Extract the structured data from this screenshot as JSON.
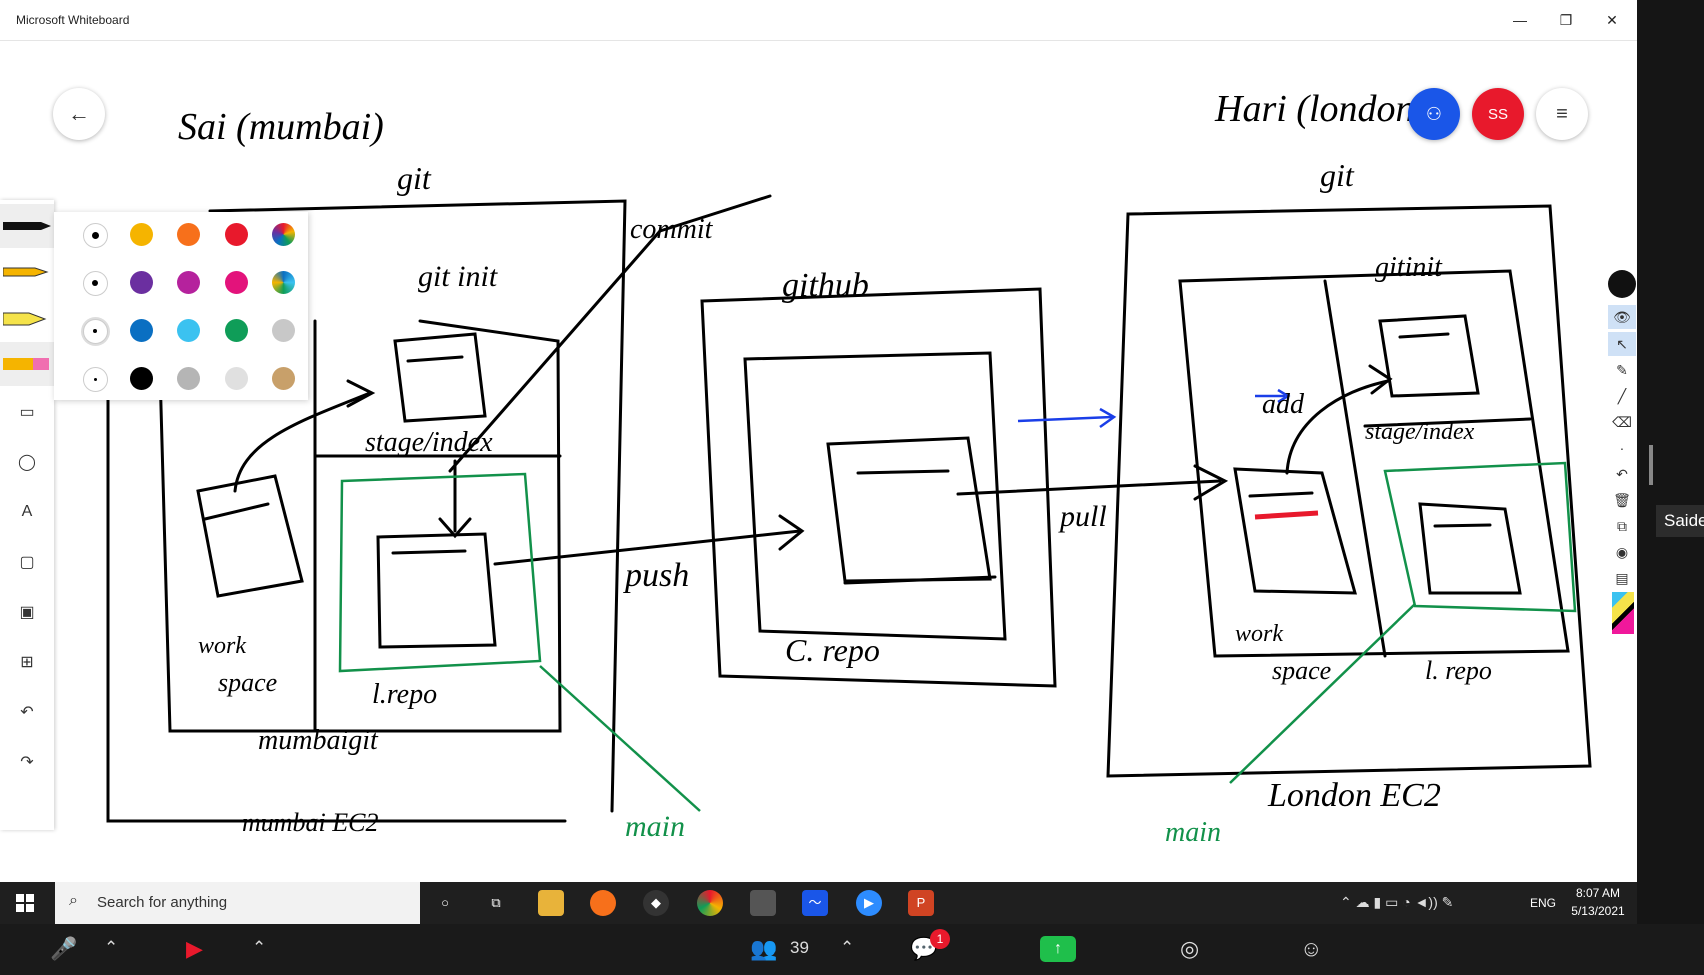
{
  "window": {
    "title": "Microsoft Whiteboard",
    "minimize": "—",
    "restore": "❐",
    "close": "✕"
  },
  "header": {
    "avatar_initials": "SS"
  },
  "sketch": {
    "left_title": "Sai (mumbai)",
    "left_git": "git",
    "git_init": "git init",
    "commit": "commit",
    "stage_index": "stage/index",
    "work_space_1": "work",
    "work_space_2": "space",
    "local_repo": "l.repo",
    "mumbai_git": "mumbaigit",
    "mumbai_ec2": "mumbai EC2",
    "main_left": "main",
    "push": "push",
    "github": "github",
    "central_repo": "C. repo",
    "pull": "pull",
    "right_title": "Hari (london)",
    "right_git": "git",
    "right_git_init": "gitinit",
    "add": "add",
    "right_stage_index": "stage/index",
    "right_work_1": "work",
    "right_work_2": "space",
    "right_local_repo": "l. repo",
    "london_ec2": "London EC2",
    "main_right": "main"
  },
  "palette": {
    "rows": [
      [
        "#000000",
        "#f5b400",
        "#f7701b",
        "#e8192c",
        "rainbow"
      ],
      [
        "#000000",
        "#6b2fa0",
        "#b5229d",
        "#e3137b",
        "spectrum"
      ],
      [
        "#000000",
        "#0a6fc2",
        "#3bc2f0",
        "#0f9d58",
        "#c8c8c8"
      ],
      [
        "#000000",
        "#000000",
        "#b5b5b5",
        "#e0e0e0",
        "#c8a06a"
      ]
    ]
  },
  "left_tools": [
    "pen-icon",
    "yellow-pen-icon",
    "highlighter-icon",
    "eraser-icon",
    "ruler-icon",
    "lasso-icon",
    "text-icon",
    "note-icon",
    "image-icon",
    "add-icon",
    "undo-icon",
    "redo-icon"
  ],
  "right_tools": [
    "eye-icon",
    "select-icon",
    "pen-icon",
    "ruler-icon",
    "eraser-icon",
    "dot-icon",
    "undo-icon",
    "trash-icon",
    "copy-icon",
    "camera-icon",
    "clipboard-icon",
    "color-icon"
  ],
  "taskbar": {
    "search_placeholder": "Search for anything",
    "time": "8:07 AM",
    "date": "5/13/2021",
    "lang": "ENG"
  },
  "zoom": {
    "participants": "39",
    "chat_badge": "1"
  },
  "side_tag": "Saide"
}
